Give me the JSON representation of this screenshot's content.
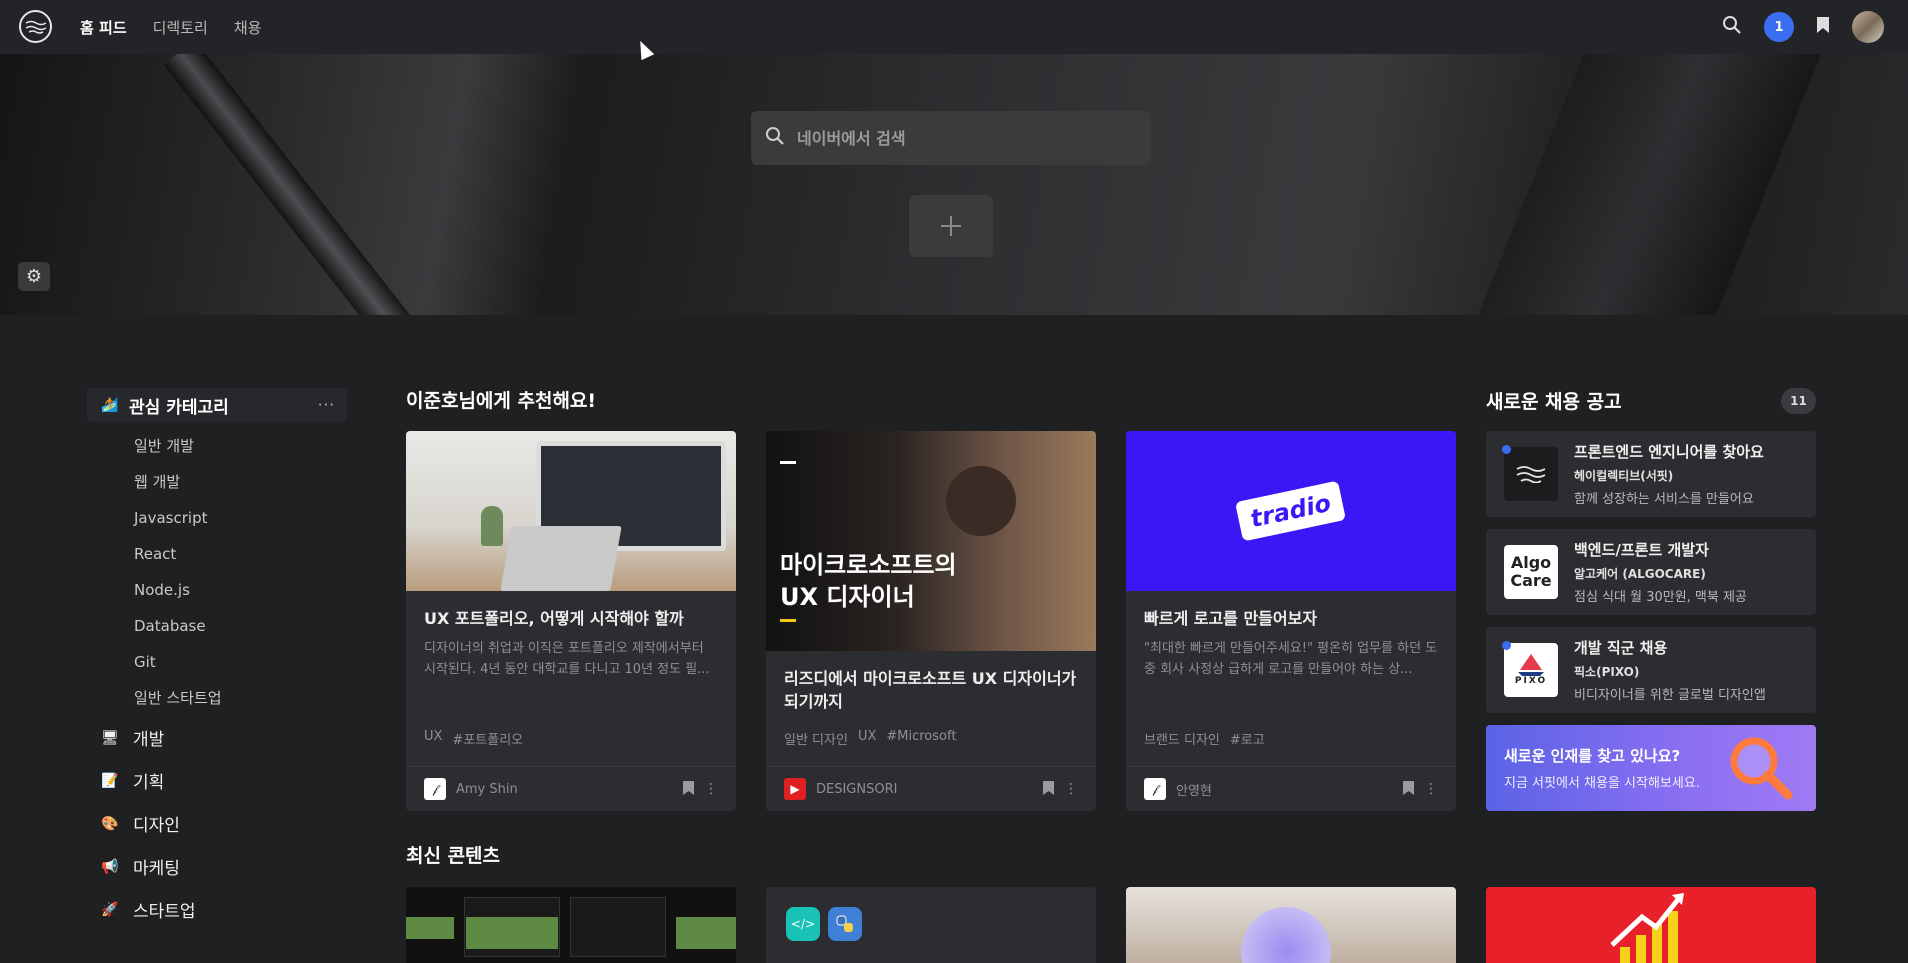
{
  "nav": {
    "items": [
      "홈 피드",
      "디렉토리",
      "채용"
    ],
    "active_index": 0,
    "notification_count": "1"
  },
  "search": {
    "placeholder": "네이버에서 검색"
  },
  "sidebar": {
    "header": "관심 카테고리",
    "more": "···",
    "subcategories": [
      "일반 개발",
      "웹 개발",
      "Javascript",
      "React",
      "Node.js",
      "Database",
      "Git",
      "일반 스타트업"
    ],
    "categories": [
      "개발",
      "기획",
      "디자인",
      "마케팅",
      "스타트업"
    ]
  },
  "recommend": {
    "title": "이준호님에게 추천해요!",
    "cards": [
      {
        "title": "UX 포트폴리오, 어떻게 시작해야 할까",
        "desc": "디자이너의 취업과 이직은 포트폴리오 제작에서부터 시작된다.  4년 동안 대학교를 다니고 10년 정도 필...",
        "tags": [
          "UX",
          "#포트폴리오"
        ],
        "source": "Amy Shin"
      },
      {
        "title": "리즈디에서 마이크로소프트 UX 디자이너가 되기까지",
        "desc": "",
        "thumb_text": "마이크로소프트의\nUX 디자이너",
        "tags": [
          "일반 디자인",
          "UX",
          "#Microsoft"
        ],
        "source": "DESIGNSORI"
      },
      {
        "title": "빠르게 로고를 만들어보자",
        "desc": "\"최대한 빠르게 만들어주세요!\" 평온히 업무를 하던 도중 회사 사정상 급하게 로고를 만들어야 하는 상...",
        "thumb_text": "tradio",
        "tags": [
          "브랜드 디자인",
          "#로고"
        ],
        "source": "안영현"
      }
    ]
  },
  "jobs": {
    "title": "새로운 채용 공고",
    "count": "11",
    "items": [
      {
        "title": "프론트엔드 엔지니어를 찾아요",
        "company": "헤이컬렉티브(서핏)",
        "desc": "함께 성장하는 서비스를 만들어요"
      },
      {
        "title": "백엔드/프론트 개발자",
        "company": "알고케어 (ALGOCARE)",
        "desc": "점심 식대 월 30만원, 맥북 제공",
        "logo_text": "Algo Care"
      },
      {
        "title": "개발 직군 채용",
        "company": "픽소(PIXO)",
        "desc": "비디자이너를 위한 글로벌 디자인앱",
        "logo_text": "PIXO"
      }
    ],
    "banner": {
      "title": "새로운 인재를 찾고 있나요?",
      "subtitle": "지금 서핏에서 채용을 시작해보세요."
    }
  },
  "latest": {
    "title": "최신 콘텐츠"
  },
  "colors": {
    "accent": "#3a6df0",
    "tradio_bg": "#3d16f5",
    "red_card": "#e8202a"
  }
}
